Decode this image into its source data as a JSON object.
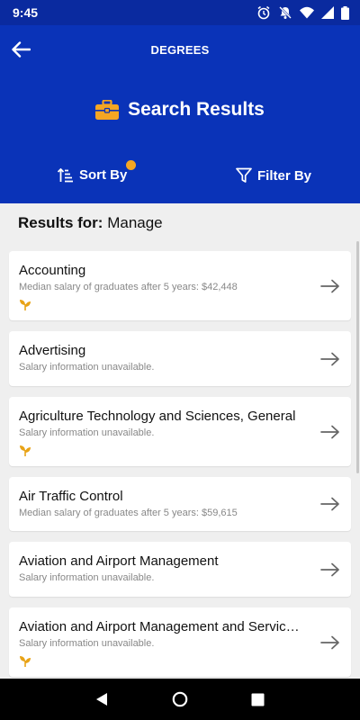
{
  "status_bar": {
    "time": "9:45"
  },
  "header": {
    "title": "DEGREES",
    "search_title": "Search Results",
    "sort_label": "Sort By",
    "filter_label": "Filter By"
  },
  "results": {
    "prefix": "Results for:",
    "query": "Manage"
  },
  "items": [
    {
      "title": "Accounting",
      "subtitle": "Median salary of graduates after 5 years: $42,448",
      "featured": true
    },
    {
      "title": "Advertising",
      "subtitle": "Salary information unavailable.",
      "featured": false
    },
    {
      "title": "Agriculture Technology and Sciences, General",
      "subtitle": "Salary information unavailable.",
      "featured": true
    },
    {
      "title": "Air Traffic Control",
      "subtitle": "Median salary of graduates after 5 years: $59,615",
      "featured": false
    },
    {
      "title": "Aviation and Airport Management",
      "subtitle": "Salary information unavailable.",
      "featured": false
    },
    {
      "title": "Aviation and Airport Management and Servic…",
      "subtitle": "Salary information unavailable.",
      "featured": true
    }
  ],
  "colors": {
    "header_bg": "#0a33b8",
    "status_bg": "#0a2a9f",
    "accent": "#f5a623",
    "leaf": "#e8a317"
  },
  "icons": {
    "back": "arrow-left-icon",
    "briefcase": "briefcase-icon",
    "sort": "sort-icon",
    "filter": "filter-icon",
    "leaf": "leaf-icon",
    "row_arrow": "arrow-right-icon"
  }
}
